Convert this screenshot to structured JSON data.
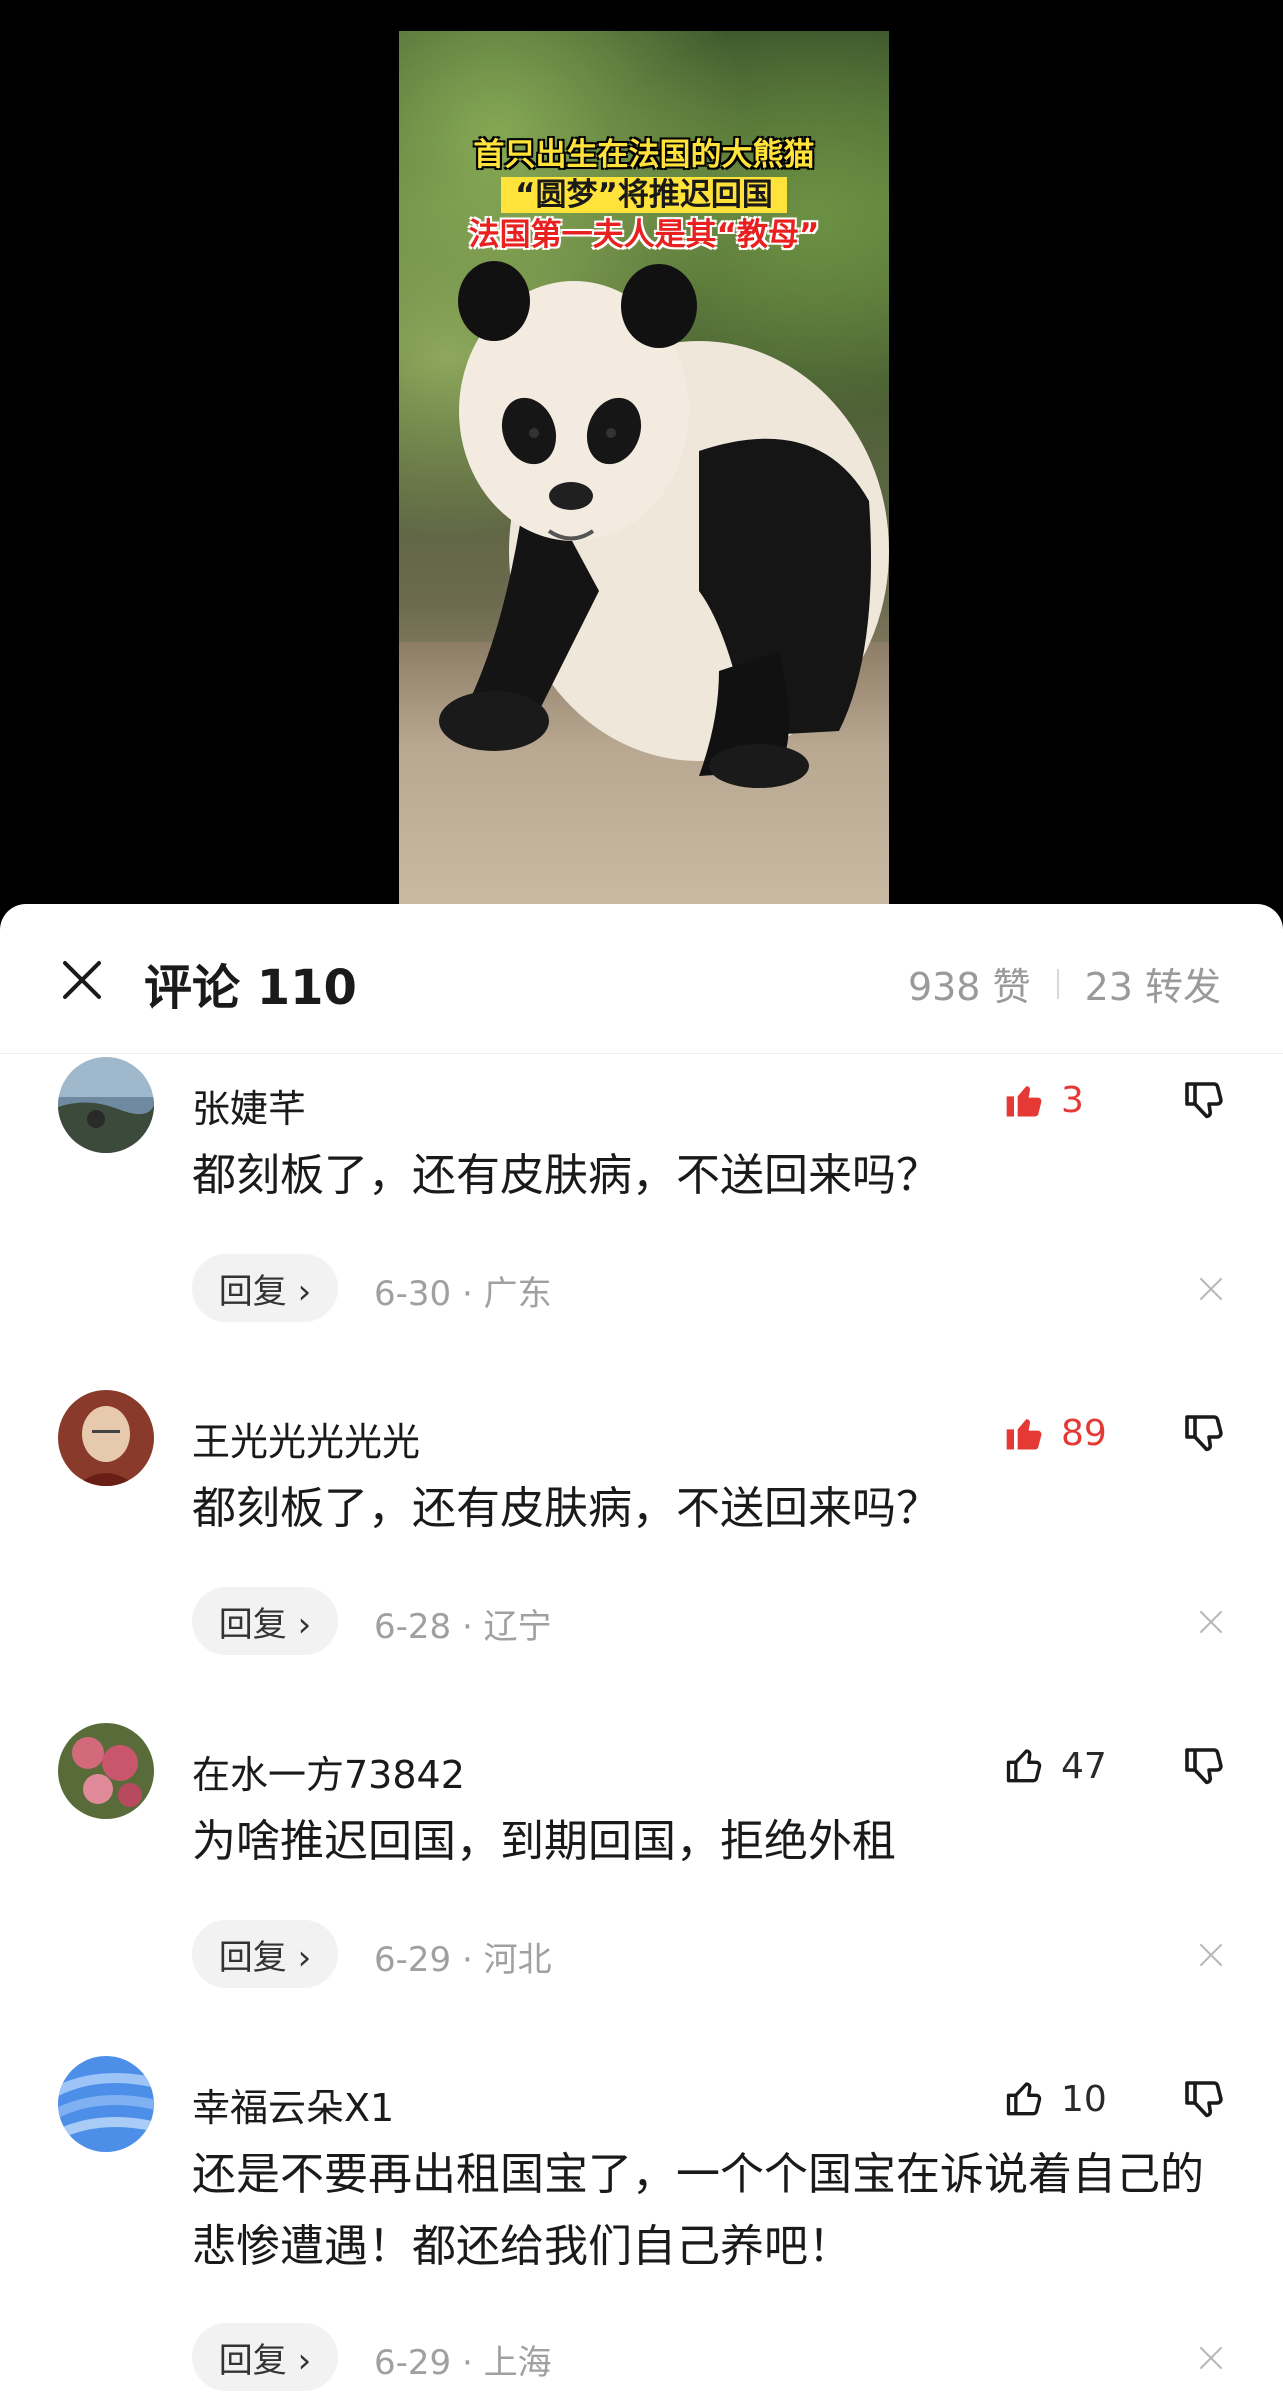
{
  "video": {
    "caption_line1": "首只出生在法国的大熊猫",
    "caption_line2": "“圆梦”将推迟回国",
    "caption_line3": "法国第一夫人是其“教母”"
  },
  "sheet": {
    "title": "评论 110",
    "likes": "938 赞",
    "shares": "23 转发"
  },
  "colors": {
    "accent_like": "#e53935",
    "text": "#1a1a1a",
    "meta": "#a0a0a0"
  },
  "comments": [
    {
      "username": "张婕芊",
      "like_count": "3",
      "liked": true,
      "text": "都刻板了，还有皮肤病，不送回来吗？",
      "reply_label": "回复 ›",
      "meta": "6-30 · 广东",
      "avatar": "lake-landscape-avatar"
    },
    {
      "username": "王光光光光光",
      "like_count": "89",
      "liked": true,
      "text": "都刻板了，还有皮肤病，不送回来吗？",
      "reply_label": "回复 ›",
      "meta": "6-28 · 辽宁",
      "avatar": "elder-portrait-avatar"
    },
    {
      "username": "在水一方73842",
      "like_count": "47",
      "liked": false,
      "text": "为啥推迟回国，到期回国，拒绝外租",
      "reply_label": "回复 ›",
      "meta": "6-29 · 河北",
      "avatar": "peach-blossom-avatar"
    },
    {
      "username": "幸福云朵X1",
      "like_count": "10",
      "liked": false,
      "text": "还是不要再出租国宝了，一个个国宝在诉说着自己的悲惨遭遇！都还给我们自己养吧！",
      "reply_label": "回复 ›",
      "meta": "6-29 · 上海",
      "avatar": "blue-wave-avatar"
    }
  ]
}
